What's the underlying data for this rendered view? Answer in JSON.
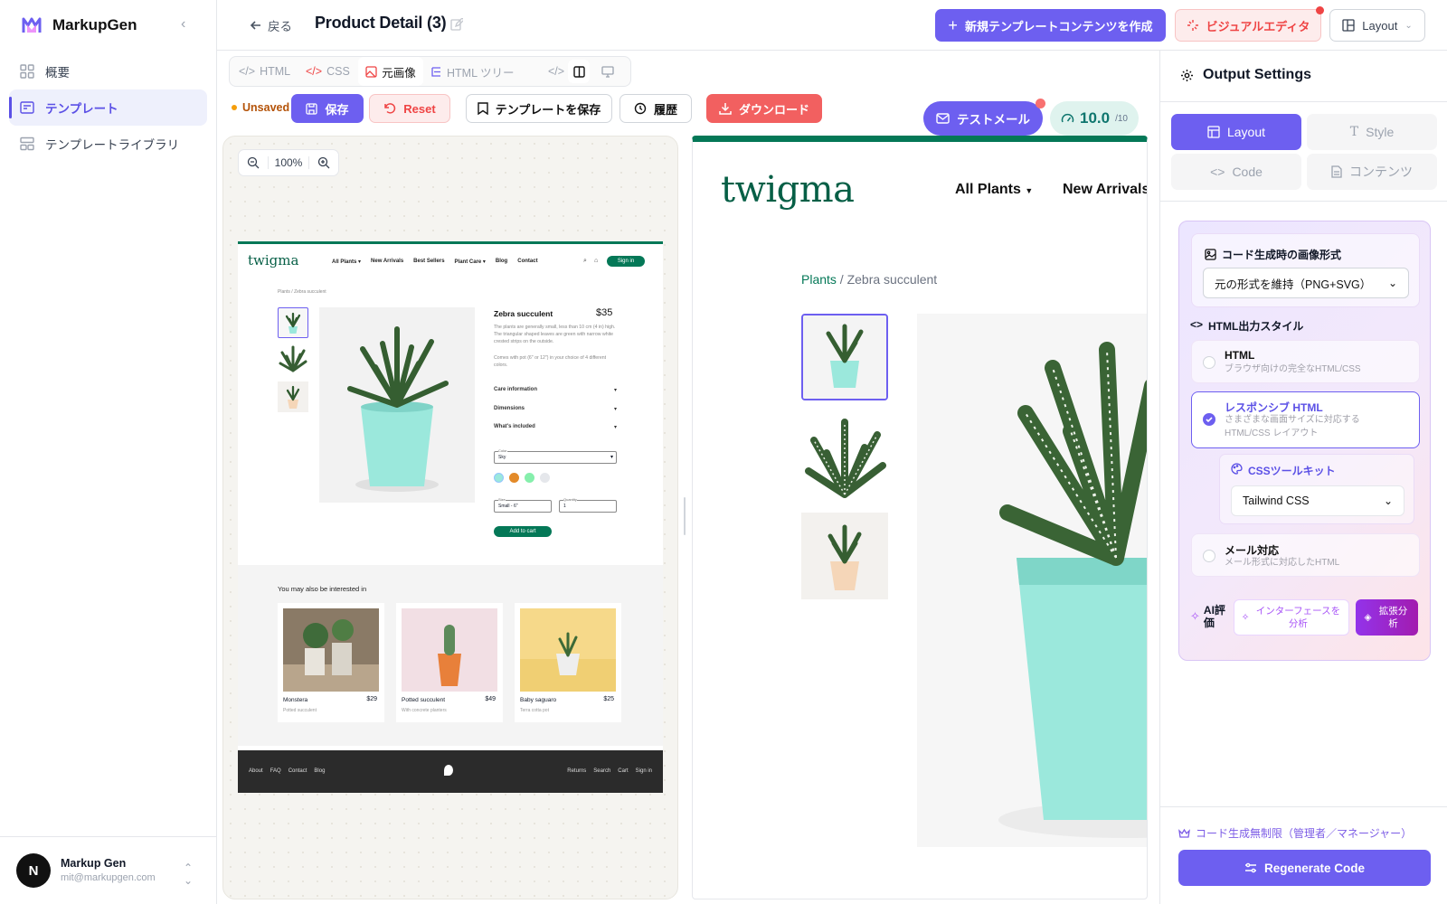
{
  "app": {
    "name": "MarkupGen"
  },
  "sidebar": {
    "items": [
      {
        "label": "概要",
        "icon": "grid-icon"
      },
      {
        "label": "テンプレート",
        "icon": "template-icon"
      },
      {
        "label": "テンプレートライブラリ",
        "icon": "library-icon"
      }
    ],
    "user": {
      "initial": "N",
      "name": "Markup Gen",
      "email": "mit@markupgen.com"
    }
  },
  "header": {
    "back_label": "戻る",
    "title": "Product Detail (3)",
    "new_button": "新規テンプレートコンテンツを作成",
    "visual_editor": "ビジュアルエディタ",
    "layout_button": "Layout"
  },
  "toolbar": {
    "tabs": [
      "HTML",
      "CSS",
      "元画像",
      "HTML ツリー"
    ],
    "active_tab": "元画像",
    "unsaved": "Unsaved",
    "save": "保存",
    "reset": "Reset",
    "template_save": "テンプレートを保存",
    "history": "履歴",
    "download": "ダウンロード",
    "test_mail": "テストメール",
    "score": "10.0",
    "score_max": "/10"
  },
  "preview": {
    "zoom": "100%",
    "mini": {
      "logo": "twigma",
      "nav": [
        "All Plants ▾",
        "New Arrivals",
        "Best Sellers",
        "Plant Care ▾",
        "Blog",
        "Contact"
      ],
      "signin": "Sign in",
      "breadcrumb": "Plants / Zebra succulent",
      "product_name": "Zebra succulent",
      "price": "$35",
      "desc1": "The plants are generally small, less than 10 cm (4 in) high. The triangular shaped leaves are green with narrow white crested strips on the outside.",
      "desc2": "Comes with pot (6\" or 12\") in your choice of 4 different colors.",
      "accordions": [
        "Care information",
        "Dimensions",
        "What's included"
      ],
      "color_label": "Color",
      "color_value": "Sky",
      "size_label": "Size",
      "size_value": "Small - 6\"",
      "qty_label": "Quantity",
      "qty_value": "1",
      "add_to_cart": "Add to cart",
      "related_title": "You may also be interested in",
      "related": [
        {
          "name": "Monstera",
          "price": "$29",
          "sub": "Potted succulent"
        },
        {
          "name": "Potted succulent",
          "price": "$49",
          "sub": "With concrete planters"
        },
        {
          "name": "Baby saguaro",
          "price": "$25",
          "sub": "Terra cotta pot"
        }
      ],
      "footer_left": [
        "About",
        "FAQ",
        "Contact",
        "Blog"
      ],
      "footer_right": [
        "Returns",
        "Search",
        "Cart",
        "Sign in"
      ]
    },
    "large": {
      "logo": "twigma",
      "nav": [
        "All Plants",
        "New Arrivals"
      ],
      "crumb_link": "Plants",
      "crumb_rest": " / Zebra succulent"
    }
  },
  "settings": {
    "title": "Output Settings",
    "tabs": [
      "Layout",
      "Style",
      "Code",
      "コンテンツ"
    ],
    "image_format_label": "コード生成時の画像形式",
    "image_format_value": "元の形式を維持（PNG+SVG）",
    "style_label": "HTML出力スタイル",
    "options": [
      {
        "title": "HTML",
        "desc": "ブラウザ向けの完全なHTML/CSS",
        "selected": false
      },
      {
        "title": "レスポンシブ HTML",
        "desc": "さまざまな画面サイズに対応する HTML/CSS レイアウト",
        "selected": true
      },
      {
        "title": "メール対応",
        "desc": "メール形式に対応したHTML",
        "selected": false
      }
    ],
    "toolkit_label": "CSSツールキット",
    "toolkit_value": "Tailwind CSS",
    "ai_label": "AI評価",
    "ai_interface": "インターフェースを分析",
    "ai_extended": "拡張分析",
    "limit_text": "コード生成無制限（管理者／マネージャー）",
    "regenerate": "Regenerate Code"
  },
  "colors": {
    "accent": "#6d5ff0",
    "brand_green": "#047857",
    "danger": "#ef4444",
    "mint_pot": "#9be8dc"
  }
}
